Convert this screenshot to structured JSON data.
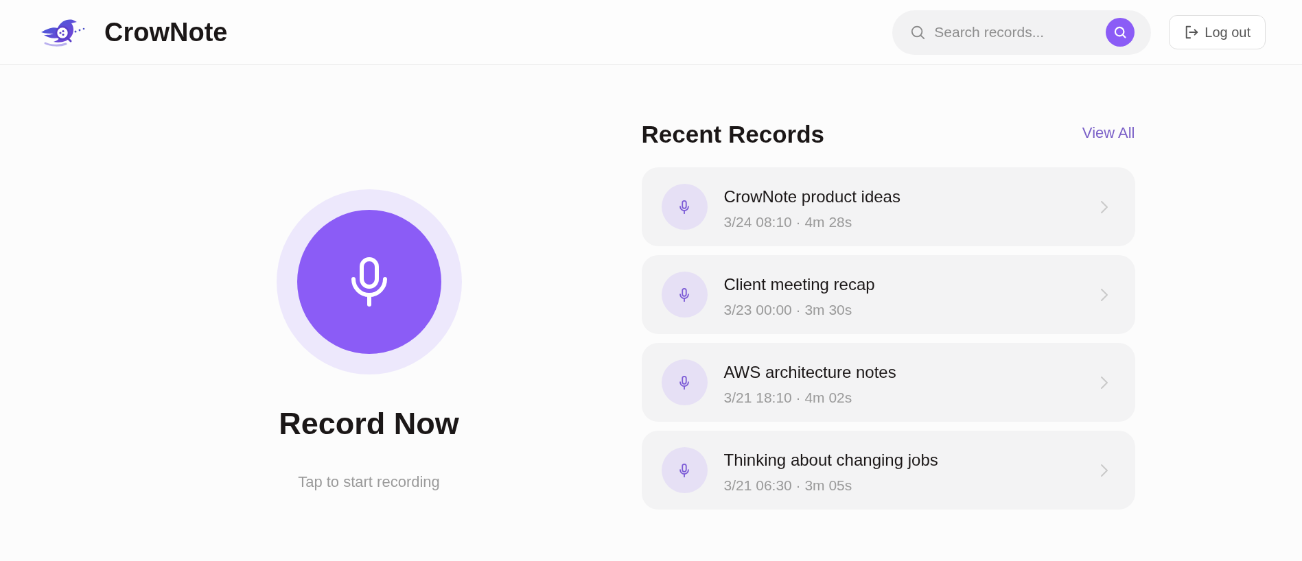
{
  "header": {
    "brand": "CrowNote",
    "search": {
      "placeholder": "Search records..."
    },
    "logout": {
      "label": "Log out"
    }
  },
  "recorder": {
    "title": "Record Now",
    "hint": "Tap to start recording"
  },
  "recent": {
    "title": "Recent Records",
    "view_all": "View All",
    "records": [
      {
        "title": "CrowNote product ideas",
        "meta": "3/24 08:10 · 4m 28s"
      },
      {
        "title": "Client meeting recap",
        "meta": "3/23 00:00 · 3m 30s"
      },
      {
        "title": "AWS architecture notes",
        "meta": "3/21 18:10 · 4m 02s"
      },
      {
        "title": "Thinking about changing jobs",
        "meta": "3/21 06:30 · 3m 05s"
      }
    ]
  }
}
